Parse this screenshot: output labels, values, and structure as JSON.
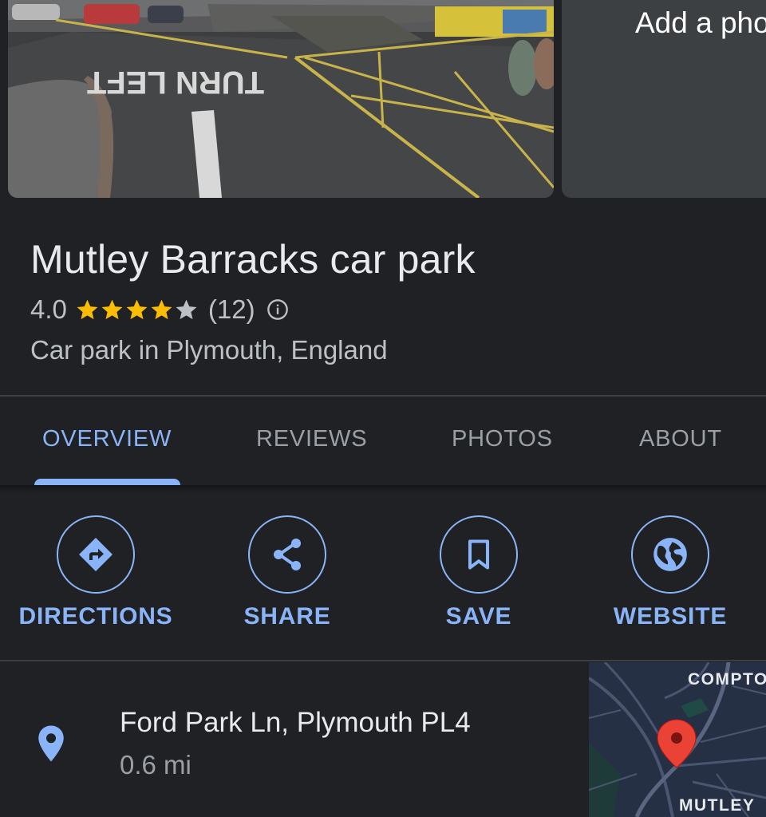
{
  "photos": {
    "add_photo_label": "Add a pho",
    "road_marking": "TURN LEFT"
  },
  "place": {
    "name": "Mutley Barracks car park",
    "rating": "4.0",
    "rating_value": 4.0,
    "rating_max": 5,
    "review_count": "(12)",
    "category": "Car park in Plymouth, England"
  },
  "tabs": [
    {
      "label": "OVERVIEW",
      "active": true
    },
    {
      "label": "REVIEWS",
      "active": false
    },
    {
      "label": "PHOTOS",
      "active": false
    },
    {
      "label": "ABOUT",
      "active": false
    }
  ],
  "actions": [
    {
      "label": "DIRECTIONS",
      "icon": "directions-icon"
    },
    {
      "label": "SHARE",
      "icon": "share-icon"
    },
    {
      "label": "SAVE",
      "icon": "bookmark-icon"
    },
    {
      "label": "WEBSITE",
      "icon": "globe-icon"
    }
  ],
  "address": {
    "line": "Ford Park Ln, Plymouth PL4",
    "distance": "0.6 mi",
    "icon": "location-pin-icon"
  },
  "map": {
    "labels": [
      "COMPTO",
      "MUTLEY"
    ],
    "marker_icon": "map-marker-icon"
  },
  "colors": {
    "background": "#202124",
    "accent": "#8ab4f8",
    "star": "#fbbc04",
    "primary_text": "#e8eaed",
    "secondary_text": "#bdc1c6",
    "marker": "#ea4335"
  }
}
